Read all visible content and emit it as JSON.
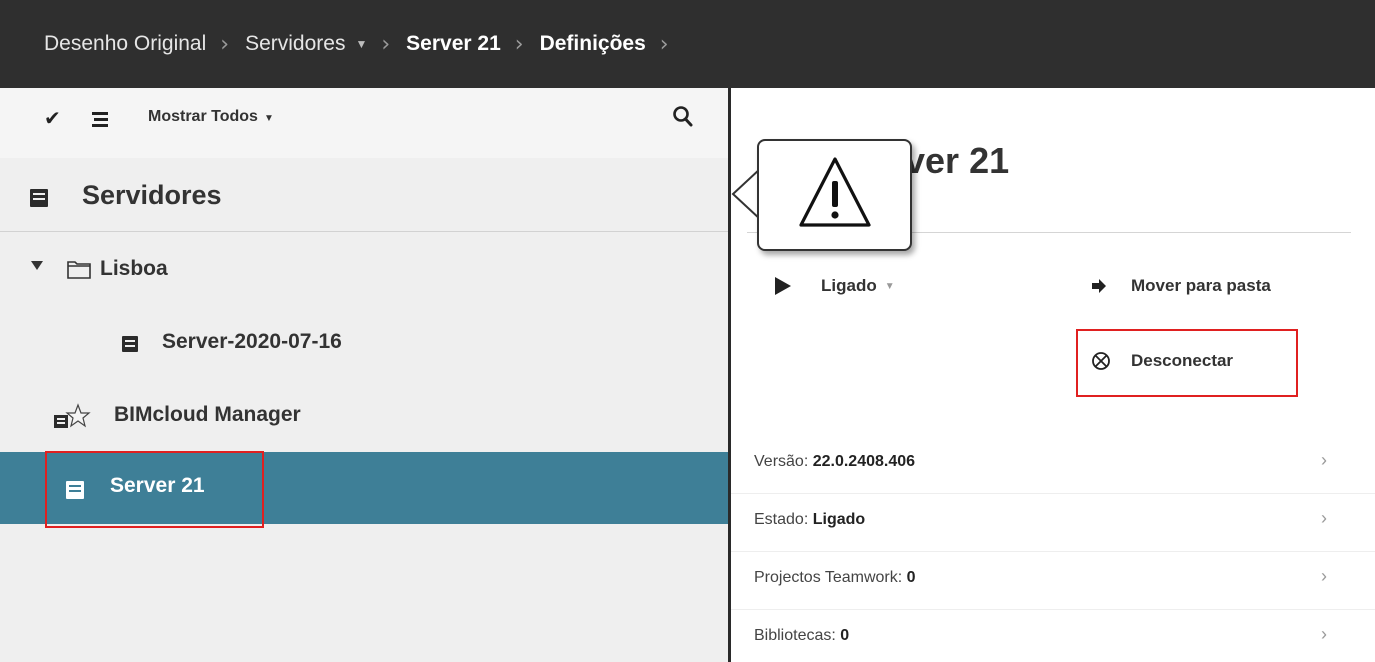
{
  "breadcrumb": {
    "items": [
      {
        "label": "Desenho Original"
      },
      {
        "label": "Servidores"
      },
      {
        "label": "Server 21"
      },
      {
        "label": "Definições"
      }
    ]
  },
  "left_panel": {
    "toolbar": {
      "check_icon": "checkmark-icon",
      "list_icon": "list-icon",
      "show_label": "Mostrar Todos",
      "search_icon": "search-icon"
    },
    "heading": "Servidores",
    "tree": [
      {
        "label": "Lisboa",
        "icon": "folder-icon",
        "expanded": true
      },
      {
        "label": "Server-2020-07-16",
        "icon": "server-icon"
      },
      {
        "label": "BIMcloud Manager",
        "icon": "manager-icon"
      },
      {
        "label": "Server 21",
        "icon": "server-icon",
        "selected": true
      }
    ]
  },
  "right_panel": {
    "title": "Server 21",
    "title_visible": "rver 21",
    "actions": {
      "status_label": "Ligado",
      "move_label": "Mover para pasta",
      "disconnect_label": "Desconectar"
    },
    "info": [
      {
        "label": "Versão:",
        "value": "22.0.2408.406"
      },
      {
        "label": "Estado:",
        "value": "Ligado"
      },
      {
        "label": "Projectos Teamwork:",
        "value": "0"
      },
      {
        "label": "Bibliotecas:",
        "value": "0"
      }
    ]
  },
  "overlay": {
    "icon": "warning-icon"
  },
  "colors": {
    "topbar": "#2f2f2f",
    "selected_row": "#3e7f97",
    "highlight_border": "#e02020",
    "panel_bg": "#efefef"
  }
}
